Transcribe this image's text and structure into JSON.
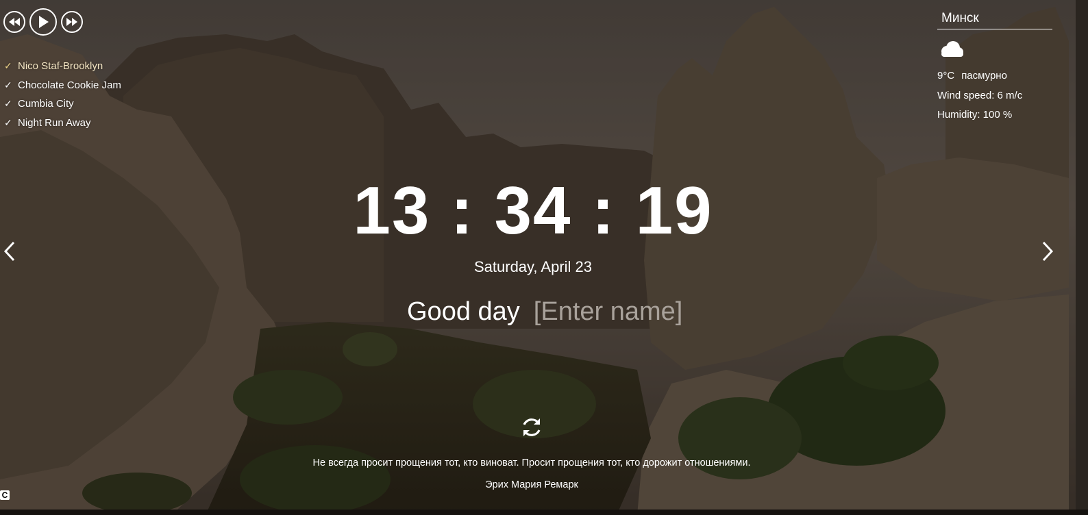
{
  "player": {
    "prev_icon": "rewind-icon",
    "play_icon": "play-icon",
    "next_icon": "fast-forward-icon",
    "playlist": [
      {
        "title": "Nico Staf-Brooklyn",
        "active": true
      },
      {
        "title": "Chocolate Cookie Jam",
        "active": false
      },
      {
        "title": "Cumbia City",
        "active": false
      },
      {
        "title": "Night Run Away",
        "active": false
      }
    ]
  },
  "weather": {
    "city": "Минск",
    "icon": "cloud-icon",
    "temperature": "9°C",
    "description": "пасмурно",
    "wind": "Wind speed: 6 m/c",
    "humidity": "Humidity: 100 %"
  },
  "clock": {
    "time": "13 : 34 : 19",
    "date": "Saturday, April 23"
  },
  "greeting": {
    "text": "Good day",
    "name_placeholder": "[Enter name]",
    "name_value": ""
  },
  "quote": {
    "text": "Не всегда просит прощения тот, кто виноват. Просит прощения тот, кто дорожит отношениями.",
    "author": "Эрих Мария Ремарк"
  },
  "corner_label": "C",
  "colors": {
    "active_track": "#f0d68a",
    "text": "#ffffff",
    "placeholder": "#a9a29b"
  }
}
